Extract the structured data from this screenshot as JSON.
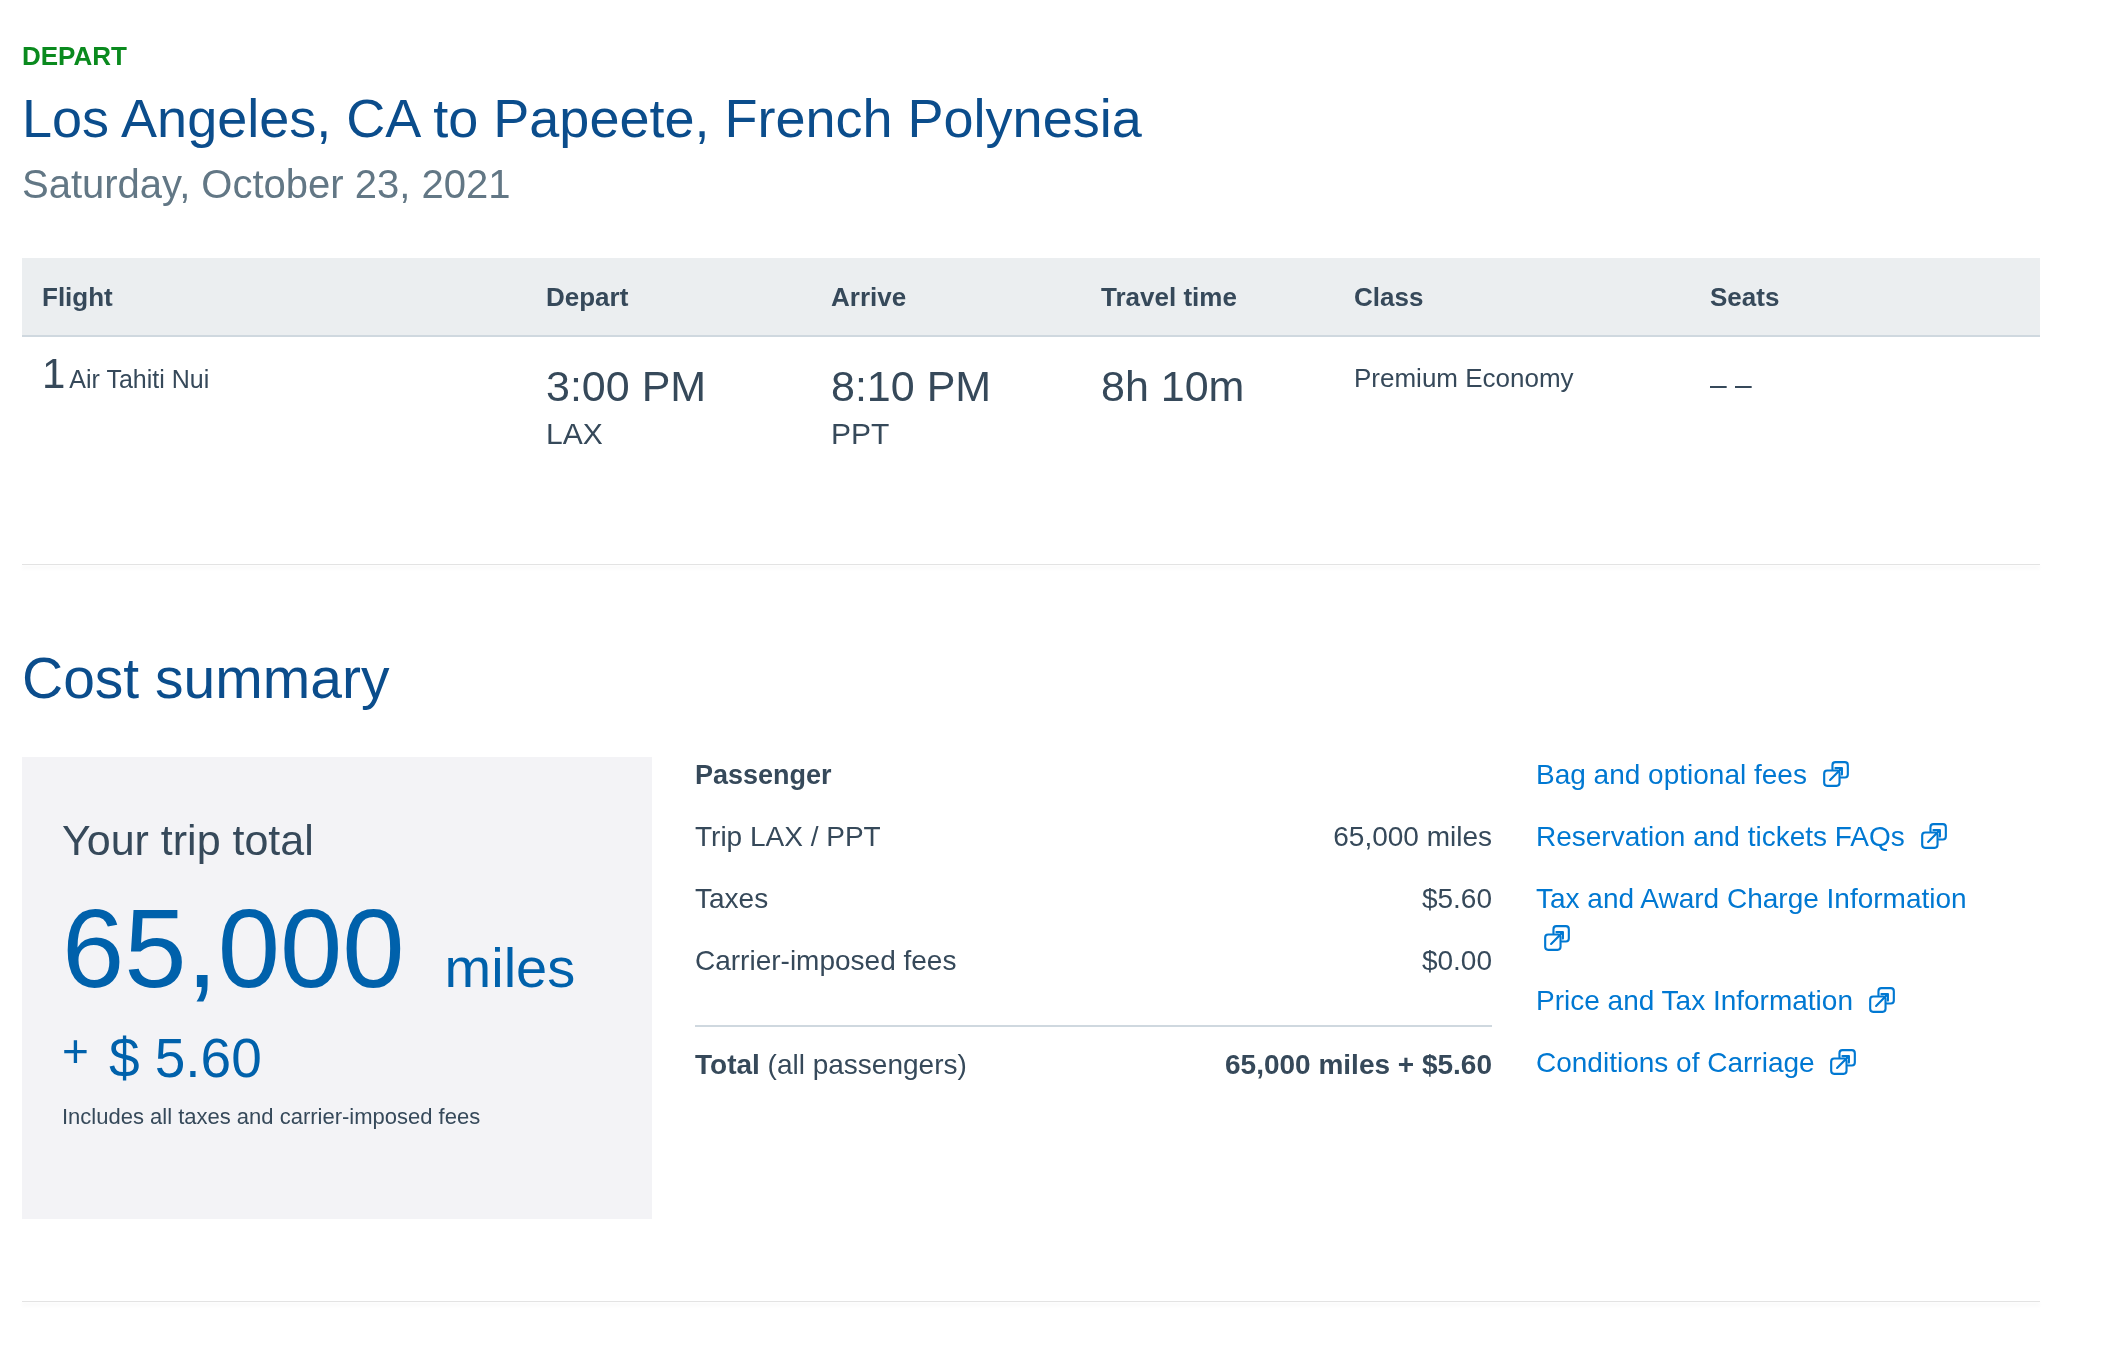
{
  "segment": {
    "direction": "DEPART",
    "route": "Los Angeles, CA to Papeete, French Polynesia",
    "date": "Saturday, October 23, 2021"
  },
  "flight_table": {
    "columns": [
      "Flight",
      "Depart",
      "Arrive",
      "Travel time",
      "Class",
      "Seats"
    ],
    "rows": [
      {
        "flight_number": "1",
        "airline": "Air Tahiti Nui",
        "depart_time": "3:00 PM",
        "depart_airport": "LAX",
        "arrive_time": "8:10 PM",
        "arrive_airport": "PPT",
        "travel_time": "8h 10m",
        "cabin_class": "Premium Economy",
        "seats": "– –"
      }
    ]
  },
  "cost_summary": {
    "title": "Cost summary",
    "trip_total": {
      "label": "Your trip total",
      "miles": "65,000",
      "miles_unit": "miles",
      "plus": "+",
      "cash": "$ 5.60",
      "note": "Includes all taxes and carrier-imposed fees"
    },
    "breakdown": {
      "heading": "Passenger",
      "lines": [
        {
          "label": "Trip LAX / PPT",
          "value": "65,000 miles"
        },
        {
          "label": "Taxes",
          "value": "$5.60"
        },
        {
          "label": "Carrier-imposed fees",
          "value": "$0.00"
        }
      ],
      "total": {
        "label": "**Total** (all passengers)",
        "value": "65,000 miles + $5.60"
      }
    },
    "links": [
      {
        "label": "Bag and optional fees",
        "external": true
      },
      {
        "label": "Reservation and tickets FAQs",
        "external": true
      },
      {
        "label": "Tax and Award Charge Information",
        "external": true
      },
      {
        "label": "Price and Tax Information",
        "external": true
      },
      {
        "label": "Conditions of Carriage",
        "external": true
      }
    ]
  }
}
